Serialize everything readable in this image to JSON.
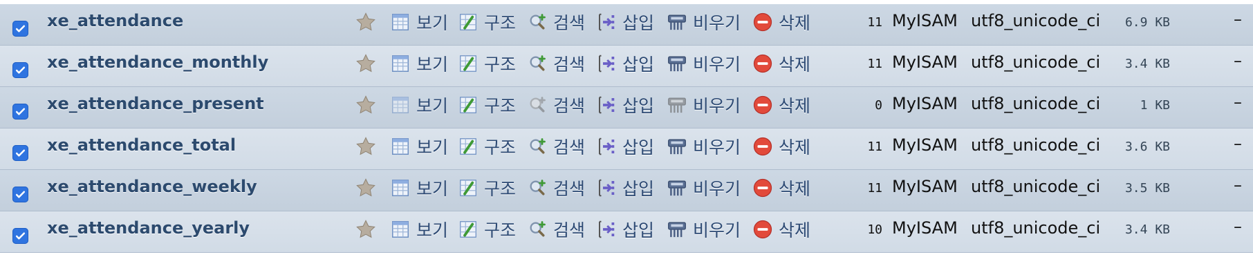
{
  "actions": {
    "browse": "보기",
    "structure": "구조",
    "search": "검색",
    "insert": "삽입",
    "empty": "비우기",
    "drop": "삭제"
  },
  "icons": {
    "favorite": "star-icon",
    "browse": "browse-table-icon",
    "structure": "structure-icon",
    "search": "search-icon",
    "insert": "insert-row-icon",
    "empty": "empty-table-icon",
    "drop": "drop-icon",
    "checkbox": "checkbox-checked"
  },
  "colors": {
    "row_band_a": "#cdd8e4",
    "row_band_b": "#dbe3ec",
    "link_text": "#2c4a6e",
    "checkbox": "#2f74e0",
    "drop_icon": "#e24a3b"
  },
  "tables": [
    {
      "name": "xe_attendance",
      "rows": "11",
      "engine": "MyISAM",
      "collation": "utf8_unicode_ci",
      "size": "6.9 KB",
      "overhead": "–",
      "checked": true
    },
    {
      "name": "xe_attendance_monthly",
      "rows": "11",
      "engine": "MyISAM",
      "collation": "utf8_unicode_ci",
      "size": "3.4 KB",
      "overhead": "–",
      "checked": true
    },
    {
      "name": "xe_attendance_present",
      "rows": "0",
      "engine": "MyISAM",
      "collation": "utf8_unicode_ci",
      "size": "1 KB",
      "overhead": "–",
      "checked": true
    },
    {
      "name": "xe_attendance_total",
      "rows": "11",
      "engine": "MyISAM",
      "collation": "utf8_unicode_ci",
      "size": "3.6 KB",
      "overhead": "–",
      "checked": true
    },
    {
      "name": "xe_attendance_weekly",
      "rows": "11",
      "engine": "MyISAM",
      "collation": "utf8_unicode_ci",
      "size": "3.5 KB",
      "overhead": "–",
      "checked": true
    },
    {
      "name": "xe_attendance_yearly",
      "rows": "10",
      "engine": "MyISAM",
      "collation": "utf8_unicode_ci",
      "size": "3.4 KB",
      "overhead": "–",
      "checked": true
    }
  ]
}
